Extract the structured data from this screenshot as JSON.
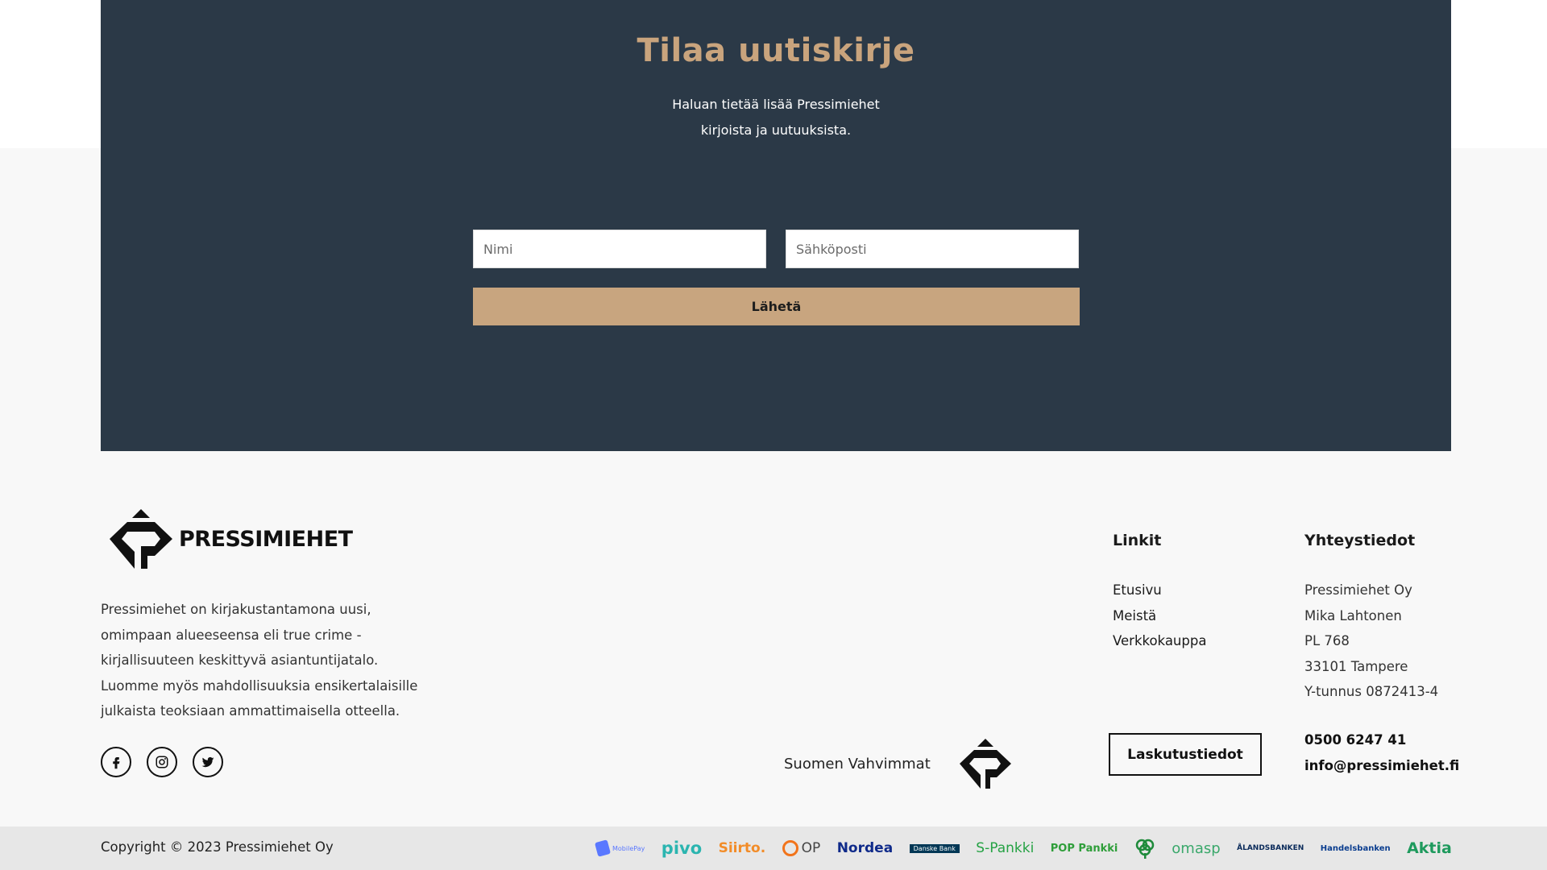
{
  "newsletter": {
    "title": "Tilaa uutiskirje",
    "subtitle_line1": "Haluan tietää lisää Pressimiehet",
    "subtitle_line2": "kirjoista ja uutuuksista.",
    "name_placeholder": "Nimi",
    "email_placeholder": "Sähköposti",
    "submit_label": "Lähetä"
  },
  "footer": {
    "logo_text": "PRESSIMIEHET",
    "about": "Pressimiehet on kirjakustantamona uusi, omimpaan alueeseensa eli true crime -kirjallisuuteen keskittyvä asiantuntijatalo. Luomme myös mahdollisuuksia ensikertalaisille julkaista teoksiaan ammattimaisella otteella.",
    "social": [
      "facebook-icon",
      "instagram-icon",
      "twitter-icon"
    ],
    "suomen_vahvimmat": "Suomen Vahvimmat",
    "links_title": "Linkit",
    "links": [
      "Etusivu",
      "Meistä",
      "Verkkokauppa"
    ],
    "contact_title": "Yhteystiedot",
    "contact": [
      "Pressimiehet Oy",
      "Mika Lahtonen",
      "PL 768",
      "33101 Tampere",
      "Y-tunnus 0872413-4"
    ],
    "phone": "0500 6247 41",
    "email": "info@pressimiehet.fi",
    "billing_label": "Laskutustiedot"
  },
  "bottom": {
    "copyright": "Copyright © 2023 Pressimiehet Oy",
    "banks": [
      "MobilePay",
      "pivo",
      "Siirto.",
      "OP",
      "Nordea",
      "Danske Bank",
      "S-Pankki",
      "POP Pankki",
      "Säästöpankki",
      "omasp",
      "ÅLANDSBANKEN",
      "Handelsbanken",
      "Aktia"
    ]
  },
  "colors": {
    "newsletter_bg": "#2b3947",
    "accent": "#c8a57f",
    "footer_bg": "#f8f8f8",
    "bottom_bar_bg": "#e7e7e7"
  }
}
